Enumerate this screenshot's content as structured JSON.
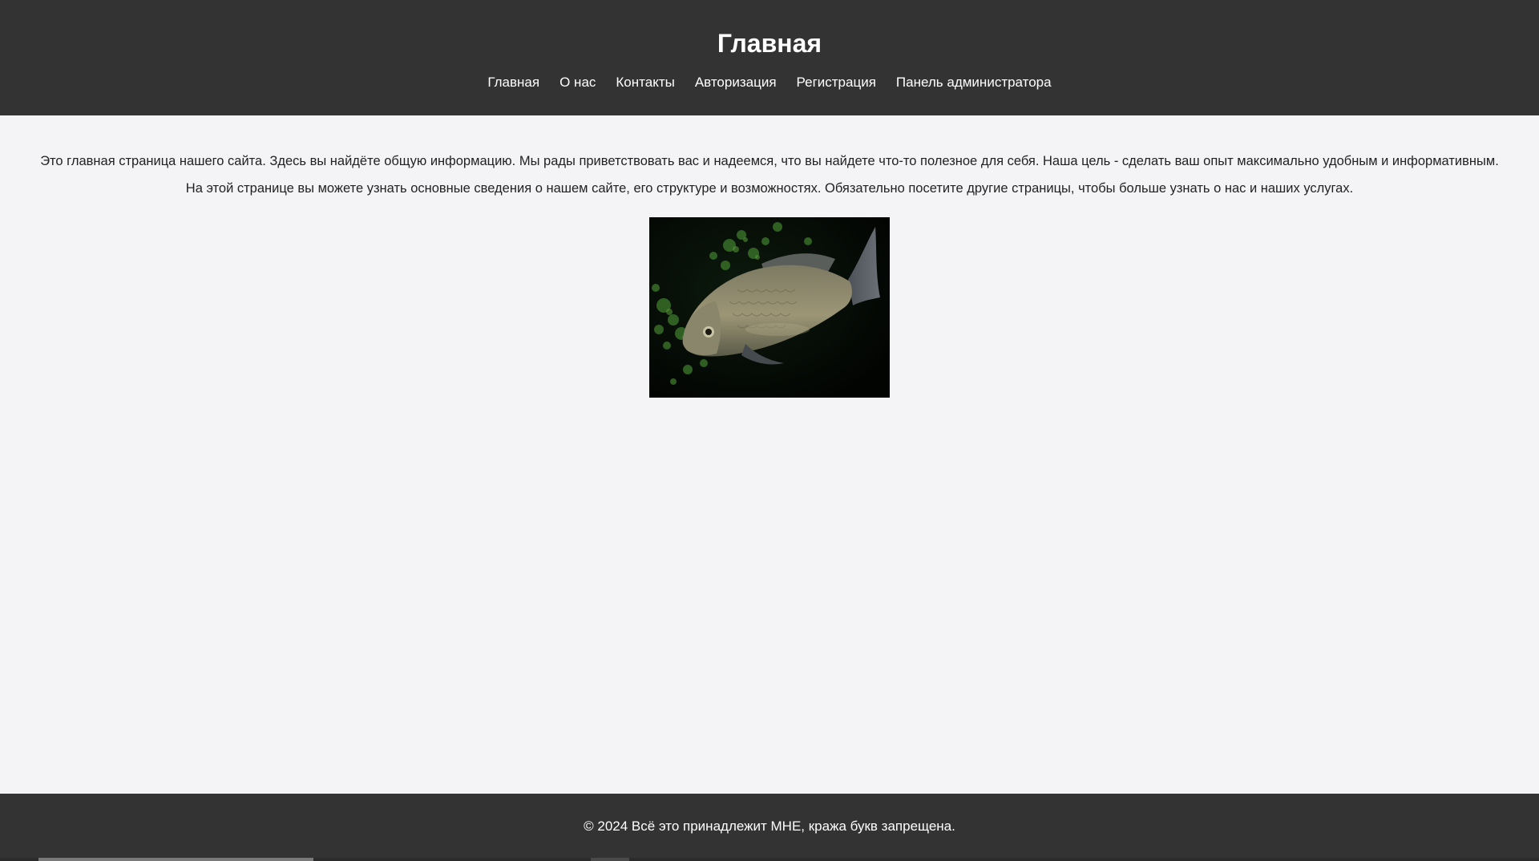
{
  "header": {
    "title": "Главная",
    "nav": [
      "Главная",
      "О нас",
      "Контакты",
      "Авторизация",
      "Регистрация",
      "Панель администратора"
    ]
  },
  "main": {
    "paragraphs": [
      "Это главная страница нашего сайта. Здесь вы найдёте общую информацию. Мы рады приветствовать вас и надеемся, что вы найдете что-то полезное для себя. Наша цель - сделать ваш опыт максимально удобным и информативным.",
      "На этой странице вы можете узнать основные сведения о нашем сайте, его структуре и возможностях. Обязательно посетите другие страницы, чтобы больше узнать о нас и наших услугах."
    ]
  },
  "footer": {
    "text": "© 2024 Всё это принадлежит МНЕ, кража букв запрещена."
  },
  "colors": {
    "header_bg": "#333333",
    "page_bg": "#f4f4f7",
    "text": "#222222",
    "nav_text": "#ffffff"
  }
}
